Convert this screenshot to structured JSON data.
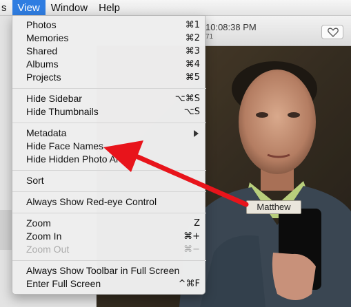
{
  "menubar": {
    "items": [
      "s",
      "View",
      "Window",
      "Help"
    ]
  },
  "toolbar": {
    "time": "10:08:38 PM",
    "sub": "71"
  },
  "view_menu": {
    "items": [
      {
        "label": "Photos",
        "shortcut": "⌘1"
      },
      {
        "label": "Memories",
        "shortcut": "⌘2"
      },
      {
        "label": "Shared",
        "shortcut": "⌘3"
      },
      {
        "label": "Albums",
        "shortcut": "⌘4"
      },
      {
        "label": "Projects",
        "shortcut": "⌘5"
      },
      {
        "label": "Hide Sidebar",
        "shortcut": "⌥⌘S"
      },
      {
        "label": "Hide Thumbnails",
        "shortcut": "⌥S"
      },
      {
        "label": "Metadata",
        "shortcut": ""
      },
      {
        "label": "Hide Face Names",
        "shortcut": ""
      },
      {
        "label": "Hide Hidden Photo Al",
        "shortcut": ""
      },
      {
        "label": "Sort",
        "shortcut": ""
      },
      {
        "label": "Always Show Red-eye Control",
        "shortcut": ""
      },
      {
        "label": "Zoom",
        "shortcut": "Z"
      },
      {
        "label": "Zoom In",
        "shortcut": "⌘+"
      },
      {
        "label": "Zoom Out",
        "shortcut": "⌘−"
      },
      {
        "label": "Always Show Toolbar in Full Screen",
        "shortcut": ""
      },
      {
        "label": "Enter Full Screen",
        "shortcut": "^⌘F"
      }
    ]
  },
  "face_tag": "Matthew",
  "colors": {
    "menu_highlight": "#2f7de1",
    "arrow": "#e8141b",
    "disabled_text": "#ababab"
  }
}
